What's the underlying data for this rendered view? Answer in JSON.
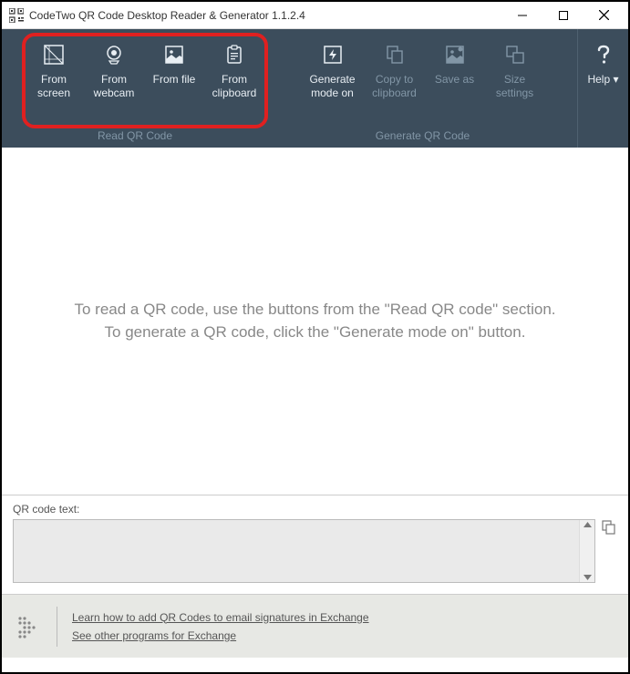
{
  "window": {
    "title": "CodeTwo QR Code Desktop Reader & Generator 1.1.2.4"
  },
  "toolbar": {
    "read_group_label": "Read QR Code",
    "gen_group_label": "Generate QR Code",
    "from_screen": "From screen",
    "from_webcam": "From webcam",
    "from_file": "From file",
    "from_clipboard": "From clipboard",
    "generate_mode": "Generate mode on",
    "copy_to_clipboard": "Copy to clipboard",
    "save_as": "Save as",
    "size_settings": "Size settings",
    "help": "Help"
  },
  "content": {
    "line1": "To read a QR code, use the buttons from the \"Read QR code\" section.",
    "line2": "To generate a QR code, click the \"Generate mode on\" button."
  },
  "qr_text": {
    "label": "QR code text:"
  },
  "footer": {
    "link1": "Learn how to add QR Codes to email signatures in Exchange",
    "link2": "See other programs for Exchange"
  }
}
